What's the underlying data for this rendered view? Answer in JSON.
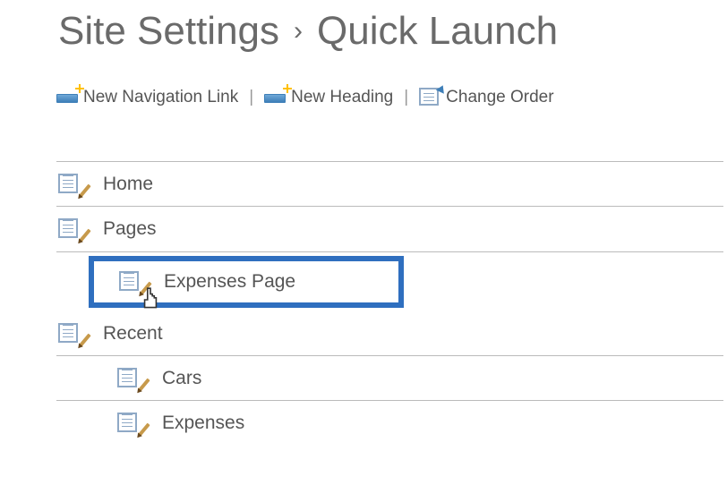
{
  "breadcrumb": {
    "parent": "Site Settings",
    "separator": "›",
    "current": "Quick Launch"
  },
  "toolbar": {
    "new_link_label": "New Navigation Link",
    "new_heading_label": "New Heading",
    "change_order_label": "Change Order",
    "separator": "|"
  },
  "nav_items": {
    "home": "Home",
    "pages": "Pages",
    "expenses_page": "Expenses Page",
    "recent": "Recent",
    "cars": "Cars",
    "expenses": "Expenses"
  }
}
